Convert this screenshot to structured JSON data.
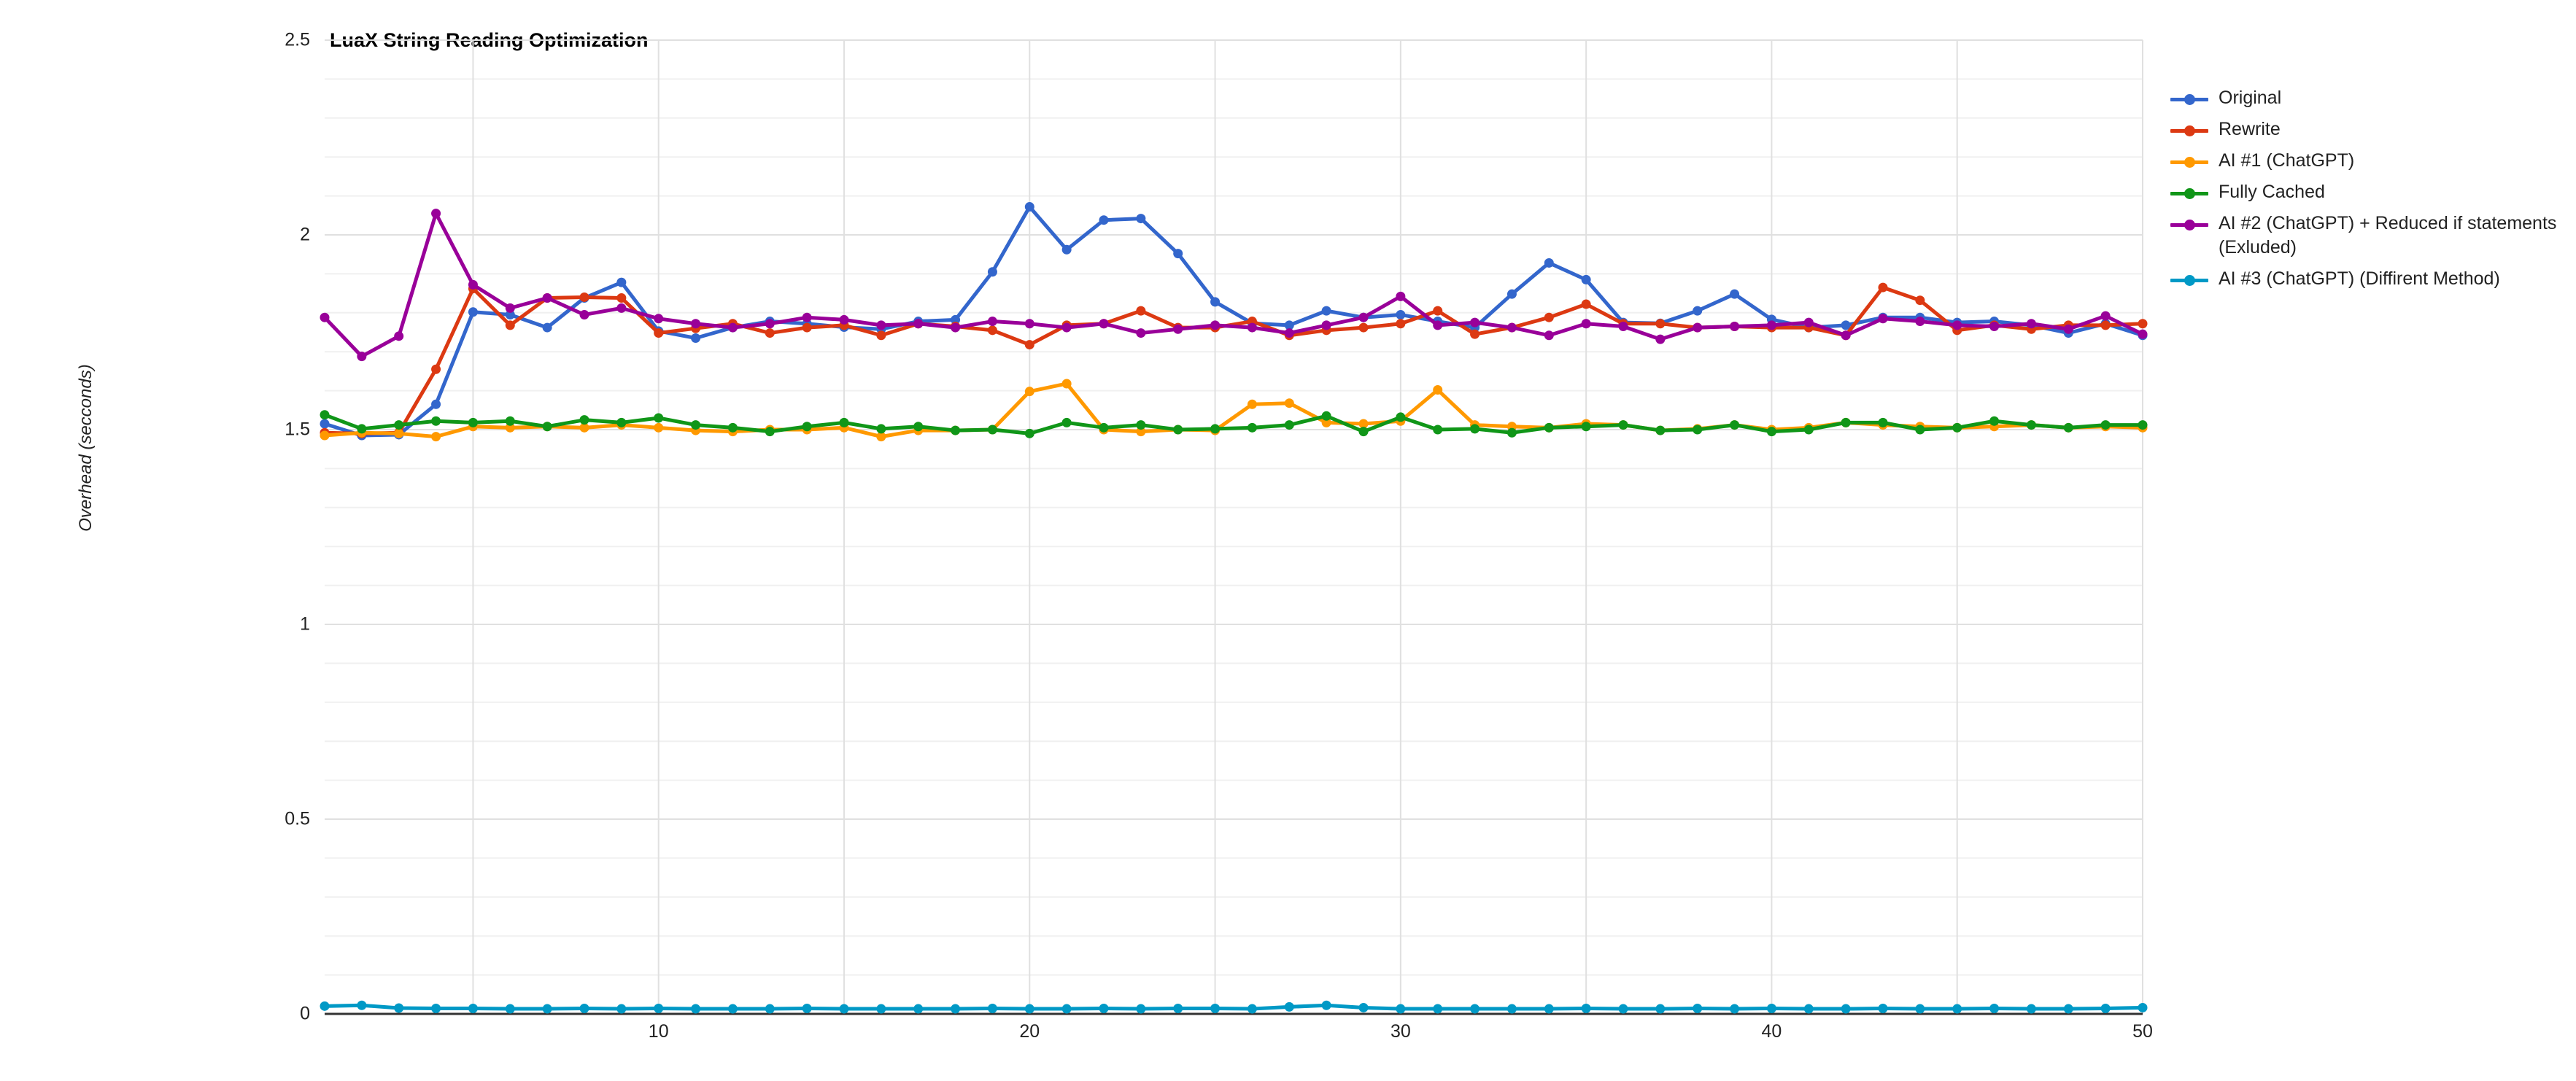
{
  "chart_data": {
    "type": "line",
    "title": "LuaX String Reading Optimization",
    "xlabel": "",
    "ylabel": "Overhead (secconds)",
    "xlim": [
      1,
      50
    ],
    "ylim": [
      0,
      2.5
    ],
    "grid": true,
    "legend_position": "right",
    "y_ticks": [
      "2.5",
      "2",
      "1.5",
      "1",
      "0.5",
      "0"
    ],
    "y_tick_values": [
      2.5,
      2,
      1.5,
      1,
      0.5,
      0
    ],
    "x_ticks": [
      "10",
      "20",
      "30",
      "40",
      "50"
    ],
    "x_tick_values": [
      10,
      20,
      30,
      40,
      50
    ],
    "x": [
      1,
      2,
      3,
      4,
      5,
      6,
      7,
      8,
      9,
      10,
      11,
      12,
      13,
      14,
      15,
      16,
      17,
      18,
      19,
      20,
      21,
      22,
      23,
      24,
      25,
      26,
      27,
      28,
      29,
      30,
      31,
      32,
      33,
      34,
      35,
      36,
      37,
      38,
      39,
      40,
      41,
      42,
      43,
      44,
      45,
      46,
      47,
      48,
      49,
      50
    ],
    "series": [
      {
        "name": "Original",
        "color": "#3366cc",
        "values": [
          1.515,
          1.485,
          1.487,
          1.565,
          1.802,
          1.795,
          1.762,
          1.838,
          1.878,
          1.753,
          1.735,
          1.762,
          1.778,
          1.772,
          1.763,
          1.758,
          1.778,
          1.782,
          1.905,
          2.072,
          1.962,
          2.038,
          2.042,
          1.952,
          1.828,
          1.773,
          1.768,
          1.805,
          1.788,
          1.795,
          1.778,
          1.762,
          1.848,
          1.928,
          1.885,
          1.775,
          1.773,
          1.805,
          1.848,
          1.783,
          1.762,
          1.768,
          1.788,
          1.788,
          1.775,
          1.778,
          1.768,
          1.748,
          1.772,
          1.742
        ]
      },
      {
        "name": "Rewrite",
        "color": "#dc3912",
        "values": [
          1.492,
          1.49,
          1.492,
          1.655,
          1.862,
          1.768,
          1.838,
          1.84,
          1.838,
          1.748,
          1.76,
          1.772,
          1.748,
          1.762,
          1.768,
          1.742,
          1.772,
          1.765,
          1.755,
          1.718,
          1.768,
          1.772,
          1.805,
          1.762,
          1.762,
          1.778,
          1.742,
          1.755,
          1.762,
          1.772,
          1.805,
          1.745,
          1.762,
          1.788,
          1.822,
          1.772,
          1.772,
          1.762,
          1.765,
          1.762,
          1.762,
          1.742,
          1.865,
          1.832,
          1.755,
          1.768,
          1.758,
          1.768,
          1.768,
          1.772
        ]
      },
      {
        "name": "AI #1 (ChatGPT)",
        "color": "#ff9900",
        "values": [
          1.485,
          1.492,
          1.49,
          1.482,
          1.508,
          1.505,
          1.508,
          1.505,
          1.512,
          1.505,
          1.498,
          1.495,
          1.5,
          1.5,
          1.505,
          1.482,
          1.498,
          1.498,
          1.5,
          1.598,
          1.618,
          1.5,
          1.495,
          1.5,
          1.498,
          1.565,
          1.568,
          1.518,
          1.515,
          1.522,
          1.602,
          1.512,
          1.508,
          1.505,
          1.515,
          1.512,
          1.498,
          1.502,
          1.512,
          1.5,
          1.505,
          1.518,
          1.512,
          1.508,
          1.505,
          1.508,
          1.512,
          1.505,
          1.508,
          1.505
        ]
      },
      {
        "name": "Fully Cached",
        "color": "#109618",
        "values": [
          1.538,
          1.502,
          1.512,
          1.522,
          1.518,
          1.522,
          1.508,
          1.525,
          1.518,
          1.53,
          1.512,
          1.505,
          1.495,
          1.508,
          1.518,
          1.502,
          1.508,
          1.498,
          1.5,
          1.49,
          1.518,
          1.505,
          1.512,
          1.5,
          1.502,
          1.505,
          1.512,
          1.535,
          1.495,
          1.532,
          1.5,
          1.502,
          1.492,
          1.505,
          1.508,
          1.512,
          1.498,
          1.5,
          1.512,
          1.495,
          1.5,
          1.518,
          1.518,
          1.5,
          1.505,
          1.522,
          1.512,
          1.505,
          1.512,
          1.512
        ]
      },
      {
        "name": "AI #2 (ChatGPT) + Reduced if statements (Exluded)",
        "color": "#990099",
        "values": [
          1.788,
          1.688,
          1.74,
          2.055,
          1.872,
          1.812,
          1.838,
          1.795,
          1.812,
          1.785,
          1.772,
          1.762,
          1.772,
          1.788,
          1.782,
          1.768,
          1.772,
          1.762,
          1.778,
          1.772,
          1.762,
          1.772,
          1.748,
          1.758,
          1.768,
          1.762,
          1.748,
          1.768,
          1.788,
          1.842,
          1.768,
          1.775,
          1.762,
          1.742,
          1.772,
          1.765,
          1.732,
          1.762,
          1.765,
          1.768,
          1.775,
          1.742,
          1.785,
          1.778,
          1.768,
          1.765,
          1.772,
          1.758,
          1.792,
          1.745
        ]
      },
      {
        "name": "AI #3 (ChatGPT) (Diffirent Method)",
        "color": "#0099c6",
        "values": [
          0.02,
          0.022,
          0.015,
          0.014,
          0.014,
          0.013,
          0.013,
          0.014,
          0.013,
          0.014,
          0.013,
          0.013,
          0.013,
          0.014,
          0.013,
          0.013,
          0.013,
          0.013,
          0.014,
          0.013,
          0.013,
          0.014,
          0.013,
          0.014,
          0.014,
          0.013,
          0.018,
          0.022,
          0.016,
          0.013,
          0.013,
          0.013,
          0.013,
          0.013,
          0.014,
          0.013,
          0.013,
          0.014,
          0.013,
          0.014,
          0.013,
          0.013,
          0.014,
          0.013,
          0.013,
          0.014,
          0.013,
          0.013,
          0.014,
          0.016
        ]
      }
    ]
  }
}
